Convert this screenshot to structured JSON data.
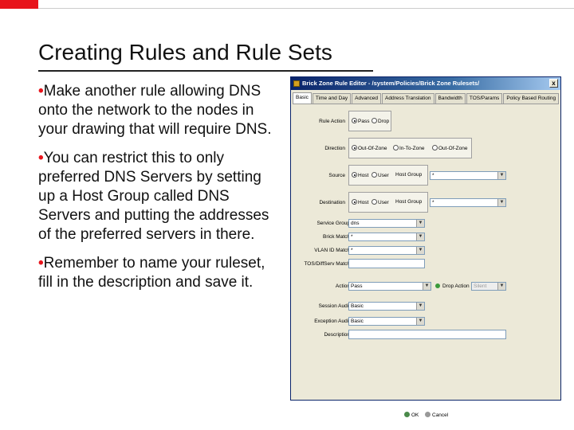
{
  "slide": {
    "title": "Creating Rules and Rule Sets",
    "bullets": [
      "Make another rule allowing DNS onto the network to the nodes in your drawing that will require DNS.",
      "You can restrict this to only preferred DNS Servers by setting up a Host Group called DNS Servers and putting the addresses of the preferred servers in there.",
      "Remember to name your ruleset, fill in the description and save it."
    ],
    "bullet_glyph": "•"
  },
  "dialog": {
    "title": "Brick Zone Rule Editor - /system/Policies/Brick Zone Rulesets/",
    "close_glyph": "x",
    "tabs": [
      "Basic",
      "Time and Day",
      "Advanced",
      "Address Translation",
      "Bandwidth",
      "TOS/Params",
      "Policy Based Routing"
    ],
    "rule_action": {
      "label": "Rule Action",
      "options": [
        "Pass",
        "Drop"
      ]
    },
    "direction": {
      "label": "Direction",
      "options": [
        "Out-Of-Zone",
        "In-To-Zone",
        "Out-Of-Zone"
      ]
    },
    "source": {
      "label": "Source",
      "options": [
        "Host",
        "User"
      ],
      "host_group_label": "Host Group",
      "host_group_value": "*"
    },
    "destination": {
      "label": "Destination",
      "options": [
        "Host",
        "User"
      ],
      "host_group_label": "Host Group",
      "host_group_value": "*"
    },
    "service_group": {
      "label": "Service Group",
      "value": "dns"
    },
    "brick_match": {
      "label": "Brick Match",
      "value": "*"
    },
    "vlan_id_match": {
      "label": "VLAN ID Match",
      "value": "*"
    },
    "tos_match": {
      "label": "TOS/DiffServ Match",
      "value": ""
    },
    "action": {
      "label": "Action",
      "value": "Pass",
      "drop_action_label": "Drop Action",
      "drop_action_value": "Silent"
    },
    "session_audit": {
      "label": "Session Audit",
      "value": "Basic"
    },
    "exception_audit": {
      "label": "Exception Audit",
      "value": "Basic"
    },
    "description": {
      "label": "Description",
      "value": ""
    },
    "buttons": {
      "ok": "OK",
      "cancel": "Cancel"
    },
    "dropdown_glyph": "▼"
  },
  "colors": {
    "accent": "#e8151c",
    "titlebar": "#0a246a",
    "dialog_bg": "#ece9d8"
  }
}
